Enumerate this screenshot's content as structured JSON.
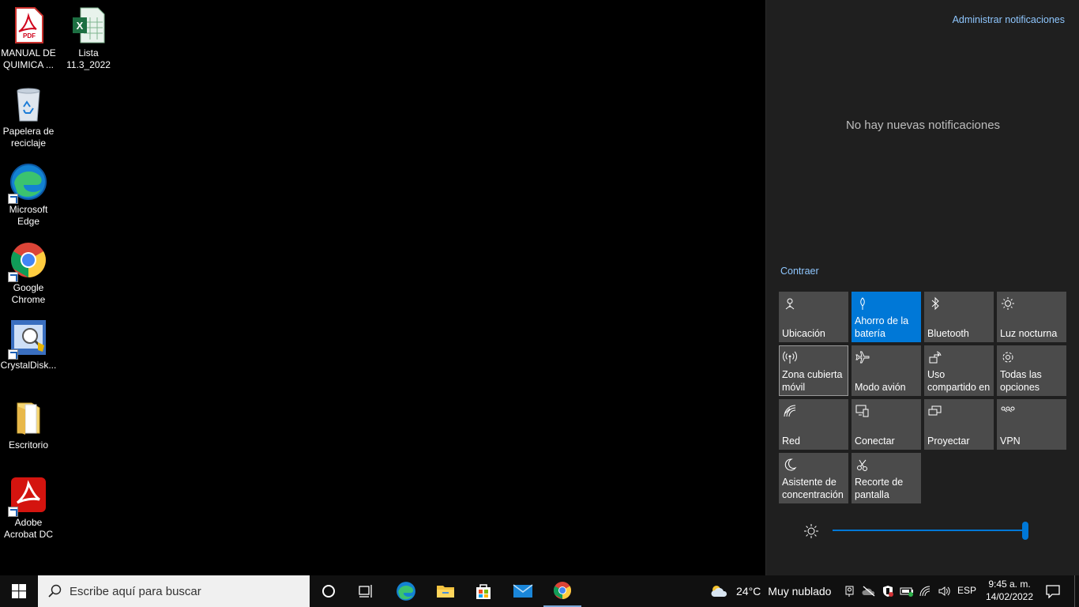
{
  "desktop": {
    "icons": [
      {
        "label": "MANUAL DE QUIMICA ...",
        "icon": "pdf-file-icon"
      },
      {
        "label": "Lista 11.3_2022",
        "icon": "excel-file-icon"
      },
      {
        "label": "Papelera de reciclaje",
        "icon": "recycle-bin-icon"
      },
      {
        "label": "Microsoft Edge",
        "icon": "edge-icon"
      },
      {
        "label": "Google Chrome",
        "icon": "chrome-icon"
      },
      {
        "label": "CrystalDisk...",
        "icon": "crystaldisk-icon"
      },
      {
        "label": "Escritorio",
        "icon": "folder-icon"
      },
      {
        "label": "Adobe Acrobat DC",
        "icon": "acrobat-icon"
      }
    ]
  },
  "action_center": {
    "manage_label": "Administrar notificaciones",
    "empty_label": "No hay nuevas notificaciones",
    "collapse_label": "Contraer",
    "tiles": [
      {
        "label": "Ubicación",
        "icon": "location-icon",
        "active": false
      },
      {
        "label": "Ahorro de la batería",
        "icon": "battery-saver-icon",
        "active": true
      },
      {
        "label": "Bluetooth",
        "icon": "bluetooth-icon",
        "active": false
      },
      {
        "label": "Luz nocturna",
        "icon": "night-light-icon",
        "active": false
      },
      {
        "label": "Zona cubierta móvil",
        "icon": "mobile-hotspot-icon",
        "active": false
      },
      {
        "label": "Modo avión",
        "icon": "airplane-icon",
        "active": false
      },
      {
        "label": "Uso compartido en",
        "icon": "nearby-share-icon",
        "active": false
      },
      {
        "label": "Todas las opciones",
        "icon": "settings-icon",
        "active": false
      },
      {
        "label": "Red",
        "icon": "network-icon",
        "active": false
      },
      {
        "label": "Conectar",
        "icon": "connect-icon",
        "active": false
      },
      {
        "label": "Proyectar",
        "icon": "project-icon",
        "active": false
      },
      {
        "label": "VPN",
        "icon": "vpn-icon",
        "active": false
      },
      {
        "label": "Asistente de concentración",
        "icon": "focus-assist-icon",
        "active": false
      },
      {
        "label": "Recorte de pantalla",
        "icon": "screen-snip-icon",
        "active": false
      }
    ],
    "brightness_level": 1.0,
    "accent": "#0078d7"
  },
  "taskbar": {
    "search_placeholder": "Escribe aquí para buscar",
    "pinned": [
      "cortana-icon",
      "task-view-icon",
      "edge-icon",
      "file-explorer-icon",
      "store-icon",
      "mail-icon",
      "chrome-icon"
    ],
    "weather_temp": "24°C",
    "weather_desc": "Muy nublado",
    "language": "ESP",
    "time": "9:45 a. m.",
    "date": "14/02/2022"
  }
}
